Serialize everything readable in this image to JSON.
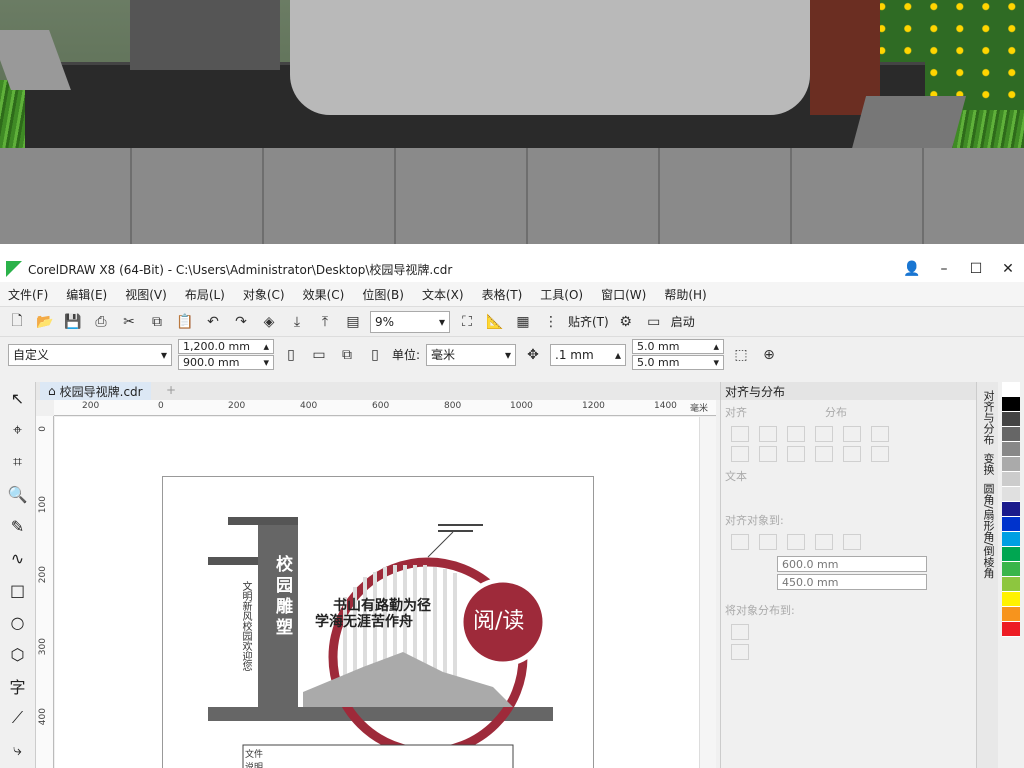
{
  "window": {
    "title": "CorelDRAW X8 (64-Bit) - C:\\Users\\Administrator\\Desktop\\校园导视牌.cdr"
  },
  "menu": [
    "文件(F)",
    "编辑(E)",
    "视图(V)",
    "布局(L)",
    "对象(C)",
    "效果(C)",
    "位图(B)",
    "文本(X)",
    "表格(T)",
    "工具(O)",
    "窗口(W)",
    "帮助(H)"
  ],
  "toolbar": {
    "zoom": "9%",
    "snap": "贴齐(T)",
    "launch": "启动"
  },
  "propbar": {
    "preset": "自定义",
    "width": "1,200.0 mm",
    "height": "900.0 mm",
    "unit_label": "单位:",
    "unit": "毫米",
    "nudge": ".1 mm",
    "dup_x": "5.0 mm",
    "dup_y": "5.0 mm"
  },
  "doc": {
    "tab": "校园导视牌.cdr",
    "ruler_unit": "毫米"
  },
  "ruler_h": [
    "200",
    "0",
    "200",
    "400",
    "600",
    "800",
    "1000",
    "1200",
    "1400"
  ],
  "ruler_v": [
    "0",
    "100",
    "200",
    "300",
    "400"
  ],
  "docker": {
    "title": "对齐与分布",
    "align": "对齐",
    "distribute": "分布",
    "text": "文本",
    "align_to": "对齐对象到:",
    "x": "600.0 mm",
    "y": "450.0 mm",
    "dist_to": "将对象分布到:"
  },
  "side_tabs": [
    "对齐与分布",
    "变换",
    "圆角/扇形角/倒棱角"
  ],
  "design": {
    "vertical_title": "校园雕塑",
    "slogan1": "书山有路勤为径",
    "slogan2": "学海无涯苦作舟",
    "badge": "阅/读",
    "side_text": "文明新风校园欢迎您",
    "file_label": "文件说明"
  },
  "palette": [
    "#ffffff",
    "#000000",
    "#444444",
    "#666666",
    "#888888",
    "#aaaaaa",
    "#cccccc",
    "#e0e0e0",
    "#1a1a8c",
    "#0033cc",
    "#009fe3",
    "#00a651",
    "#39b54a",
    "#8dc63f",
    "#fff200",
    "#f7941d",
    "#ed1c24"
  ]
}
